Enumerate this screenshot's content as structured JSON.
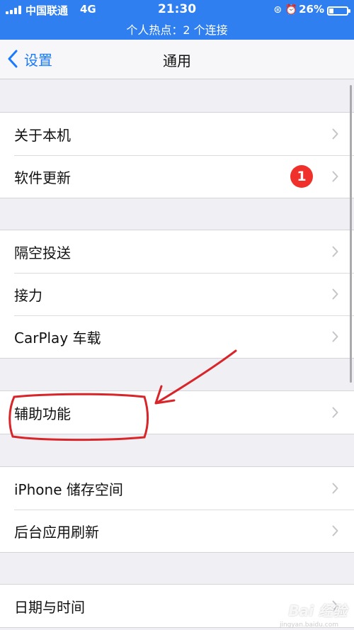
{
  "status_bar": {
    "carrier": "中国联通",
    "network": "4G",
    "time": "21:30",
    "battery_percent_text": "26%",
    "battery_level": 0.26,
    "hotspot_text": "个人热点：2 个连接",
    "color": "#2f7ff0"
  },
  "nav": {
    "back_label": "设置",
    "title": "通用",
    "accent": "#1a7aff"
  },
  "groups": [
    {
      "items": [
        {
          "label": "关于本机"
        },
        {
          "label": "软件更新",
          "badge": "1"
        }
      ]
    },
    {
      "items": [
        {
          "label": "隔空投送"
        },
        {
          "label": "接力"
        },
        {
          "label": "CarPlay 车载"
        }
      ]
    },
    {
      "items": [
        {
          "label": "辅助功能"
        }
      ]
    },
    {
      "items": [
        {
          "label": "iPhone 储存空间"
        },
        {
          "label": "后台应用刷新"
        }
      ]
    },
    {
      "items": [
        {
          "label": "日期与时间"
        }
      ]
    }
  ],
  "annotation": {
    "color": "#d8252a"
  },
  "watermark": {
    "text": "Bai 经验",
    "sub": "jingyan.baidu.com"
  }
}
